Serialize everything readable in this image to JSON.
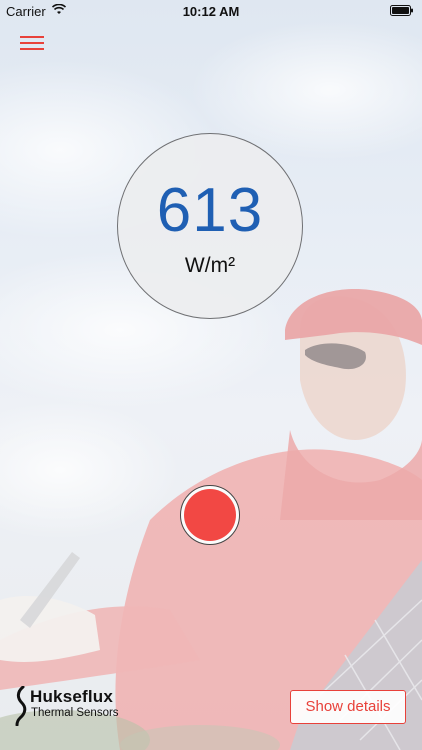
{
  "status_bar": {
    "carrier": "Carrier",
    "time": "10:12 AM",
    "battery_percent": "",
    "wifi_icon": "wifi-icon",
    "battery_icon": "battery-icon"
  },
  "header": {
    "menu_icon": "hamburger-menu-icon",
    "accent_color": "#e8413a"
  },
  "measurement": {
    "value": "613",
    "unit": "W/m²",
    "value_color": "#1f5fb3"
  },
  "record": {
    "icon": "record-icon",
    "color": "#f24844"
  },
  "footer": {
    "logo_name": "Hukseflux",
    "logo_subtitle": "Thermal Sensors",
    "details_label": "Show details"
  }
}
